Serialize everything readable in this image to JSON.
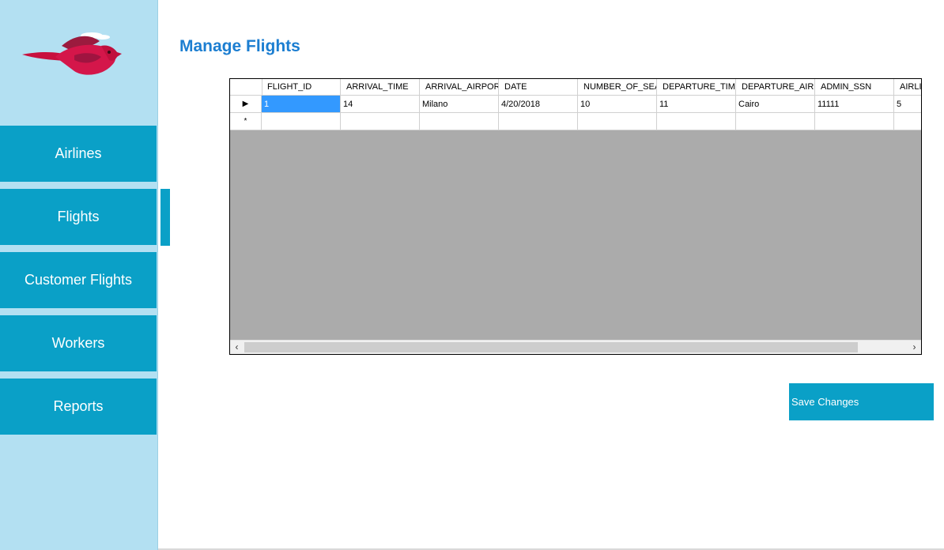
{
  "app": {
    "page_title": "Manage Flights"
  },
  "sidebar": {
    "logo_icon": "bird-logo-icon",
    "items": [
      {
        "label": "Airlines"
      },
      {
        "label": "Flights",
        "active": true
      },
      {
        "label": "Customer Flights"
      },
      {
        "label": "Workers"
      },
      {
        "label": "Reports"
      }
    ]
  },
  "grid": {
    "columns": [
      "FLIGHT_ID",
      "ARRIVAL_TIME",
      "ARRIVAL_AIRPORT",
      "DATE",
      "NUMBER_OF_SEAT",
      "DEPARTURE_TIME",
      "DEPARTURE_AIRPO",
      "ADMIN_SSN",
      "AIRLI"
    ],
    "rows": [
      {
        "marker": "▶",
        "cells": [
          "1",
          "14",
          "Milano",
          "4/20/2018",
          "10",
          "11",
          "Cairo",
          "11111",
          "5"
        ]
      },
      {
        "marker": "*",
        "cells": [
          "",
          "",
          "",
          "",
          "",
          "",
          "",
          "",
          ""
        ]
      }
    ],
    "scroll_left": "‹",
    "scroll_right": "›"
  },
  "actions": {
    "save_label": "Save Changes"
  },
  "colors": {
    "accent": "#0aa0c7",
    "sidebar_bg": "#b3e0f2",
    "title": "#1c7ed1",
    "selection": "#3399ff"
  }
}
